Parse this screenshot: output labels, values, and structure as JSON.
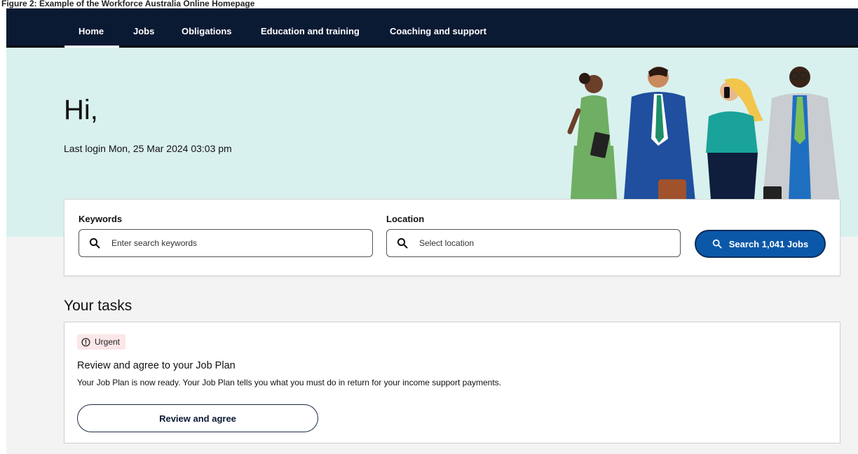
{
  "figure_caption": "Figure 2: Example of the Workforce Australia Online Homepage",
  "nav": {
    "items": [
      {
        "label": "Home"
      },
      {
        "label": "Jobs"
      },
      {
        "label": "Obligations"
      },
      {
        "label": "Education and training"
      },
      {
        "label": "Coaching and support"
      }
    ],
    "active": "Home"
  },
  "hero": {
    "greeting": "Hi,",
    "last_login": "Last login Mon, 25 Mar 2024 03:03 pm"
  },
  "search": {
    "keywords_label": "Keywords",
    "keywords_placeholder": "Enter search keywords",
    "location_label": "Location",
    "location_placeholder": "Select location",
    "button_label": "Search 1,041 Jobs"
  },
  "tasks": {
    "title": "Your tasks",
    "items": [
      {
        "badge": "Urgent",
        "heading": "Review and agree to your Job Plan",
        "description": "Your Job Plan is now ready. Your Job Plan tells you what you must do in return for your income support payments.",
        "button_label": "Review and agree"
      }
    ]
  },
  "icons": {
    "search": "search-icon",
    "urgent": "alert-circle-icon"
  },
  "colors": {
    "nav_bg": "#0b1a33",
    "hero_bg": "#d9f1ee",
    "primary_button": "#0c58a8",
    "urgent_badge_bg": "#fbe6e8"
  }
}
